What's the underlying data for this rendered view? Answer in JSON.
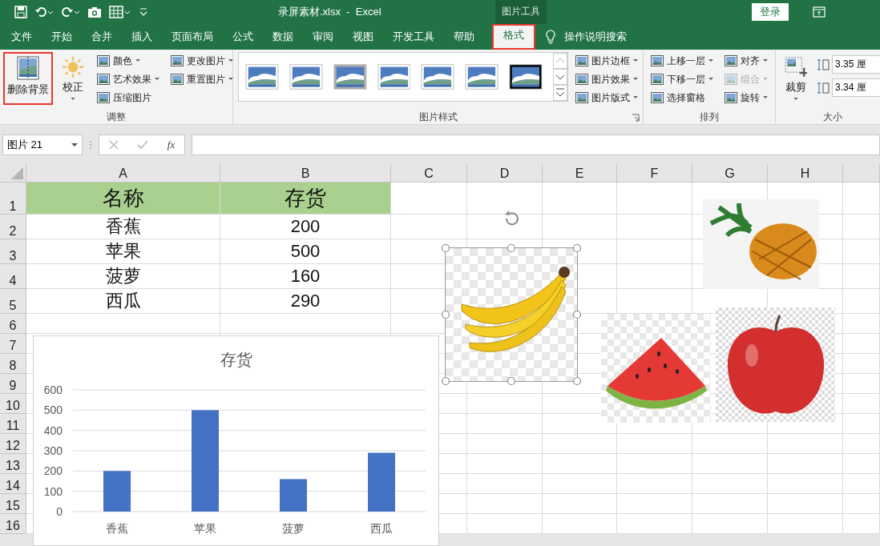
{
  "title_bar": {
    "title": "录屏素材.xlsx  -  Excel",
    "context_label": "图片工具",
    "sign_in": "登录"
  },
  "tabs": [
    {
      "label": "文件",
      "selected": false,
      "highlighted": false
    },
    {
      "label": "开始",
      "selected": false,
      "highlighted": false
    },
    {
      "label": "合并",
      "selected": false,
      "highlighted": false
    },
    {
      "label": "插入",
      "selected": false,
      "highlighted": false
    },
    {
      "label": "页面布局",
      "selected": false,
      "highlighted": false
    },
    {
      "label": "公式",
      "selected": false,
      "highlighted": false
    },
    {
      "label": "数据",
      "selected": false,
      "highlighted": false
    },
    {
      "label": "审阅",
      "selected": false,
      "highlighted": false
    },
    {
      "label": "视图",
      "selected": false,
      "highlighted": false
    },
    {
      "label": "开发工具",
      "selected": false,
      "highlighted": false
    },
    {
      "label": "帮助",
      "selected": false,
      "highlighted": false
    },
    {
      "label": "格式",
      "selected": true,
      "highlighted": true
    }
  ],
  "tell_me": "操作说明搜索",
  "ribbon": [
    {
      "kind": "buttons",
      "label": "调整",
      "launcher": false,
      "columns": [
        [
          {
            "label": "删除背景",
            "kind": "large",
            "dropdown": false,
            "disabled": false,
            "highlighted": true
          }
        ],
        [
          {
            "label": "校正",
            "kind": "large",
            "dropdown": true,
            "disabled": false,
            "highlighted": false
          }
        ],
        [
          {
            "label": "颜色",
            "kind": "small",
            "dropdown": true,
            "disabled": false,
            "highlighted": false
          },
          {
            "label": "艺术效果",
            "kind": "small",
            "dropdown": true,
            "disabled": false,
            "highlighted": false
          },
          {
            "label": "压缩图片",
            "kind": "small",
            "dropdown": false,
            "disabled": false,
            "highlighted": false
          }
        ],
        [
          {
            "label": "更改图片",
            "kind": "small",
            "dropdown": true,
            "disabled": false,
            "highlighted": false
          },
          {
            "label": "重置图片",
            "kind": "small",
            "dropdown": true,
            "disabled": false,
            "highlighted": false
          }
        ]
      ]
    },
    {
      "kind": "gallery",
      "label": "图片样式",
      "launcher": true,
      "columns": [
        [
          {
            "label": "图片边框",
            "kind": "small",
            "dropdown": true,
            "disabled": false,
            "highlighted": false
          },
          {
            "label": "图片效果",
            "kind": "small",
            "dropdown": true,
            "disabled": false,
            "highlighted": false
          },
          {
            "label": "图片版式",
            "kind": "small",
            "dropdown": true,
            "disabled": false,
            "highlighted": false
          }
        ]
      ]
    },
    {
      "kind": "buttons",
      "label": "排列",
      "launcher": false,
      "columns": [
        [
          {
            "label": "上移一层",
            "kind": "small",
            "dropdown": true,
            "disabled": false,
            "highlighted": false
          },
          {
            "label": "下移一层",
            "kind": "small",
            "dropdown": true,
            "disabled": false,
            "highlighted": false
          },
          {
            "label": "选择窗格",
            "kind": "small",
            "dropdown": false,
            "disabled": false,
            "highlighted": false
          }
        ],
        [
          {
            "label": "对齐",
            "kind": "small",
            "dropdown": true,
            "disabled": false,
            "highlighted": false
          },
          {
            "label": "组合",
            "kind": "small",
            "dropdown": true,
            "disabled": true,
            "highlighted": false
          },
          {
            "label": "旋转",
            "kind": "small",
            "dropdown": true,
            "disabled": false,
            "highlighted": false
          }
        ]
      ]
    },
    {
      "kind": "size",
      "label": "大小",
      "launcher": false,
      "columns": [
        [
          {
            "label": "裁剪",
            "kind": "large",
            "dropdown": true,
            "disabled": false,
            "highlighted": false
          }
        ]
      ],
      "fields": [
        {
          "value": "3.35 厘"
        },
        {
          "value": "3.34 厘"
        }
      ]
    }
  ],
  "formula_bar": {
    "name_box": "图片 21",
    "fx": "fx"
  },
  "sheet": {
    "columns": [
      "A",
      "B",
      "C",
      "D",
      "E",
      "F",
      "G",
      "H"
    ],
    "row_numbers": [
      "1",
      "2",
      "3",
      "4",
      "5",
      "6",
      "7",
      "8",
      "9",
      "10",
      "11",
      "12",
      "13",
      "14",
      "15",
      "16"
    ],
    "rows": [
      {
        "kind": "header",
        "values": [
          "名称",
          "存货"
        ]
      },
      {
        "kind": "data",
        "values": [
          "香蕉",
          "200"
        ]
      },
      {
        "kind": "data",
        "values": [
          "苹果",
          "500"
        ]
      },
      {
        "kind": "data",
        "values": [
          "菠萝",
          "160"
        ]
      },
      {
        "kind": "data",
        "values": [
          "西瓜",
          "290"
        ]
      }
    ],
    "chart": {
      "chart_data": {
        "type": "bar",
        "title": "存货",
        "categories": [
          "香蕉",
          "苹果",
          "菠萝",
          "西瓜"
        ],
        "series": [
          {
            "color": "#4472c4",
            "values": [
              200,
              500,
              160,
              290
            ]
          }
        ],
        "grid": true,
        "ylim": [
          0,
          600
        ],
        "yticks": [
          0,
          100,
          200,
          300,
          400,
          500,
          600
        ]
      }
    },
    "pictures": [
      {
        "kind": "banana",
        "selected": true
      },
      {
        "kind": "pineapple",
        "selected": false
      },
      {
        "kind": "watermelon",
        "selected": false
      },
      {
        "kind": "apple",
        "selected": false
      }
    ]
  }
}
